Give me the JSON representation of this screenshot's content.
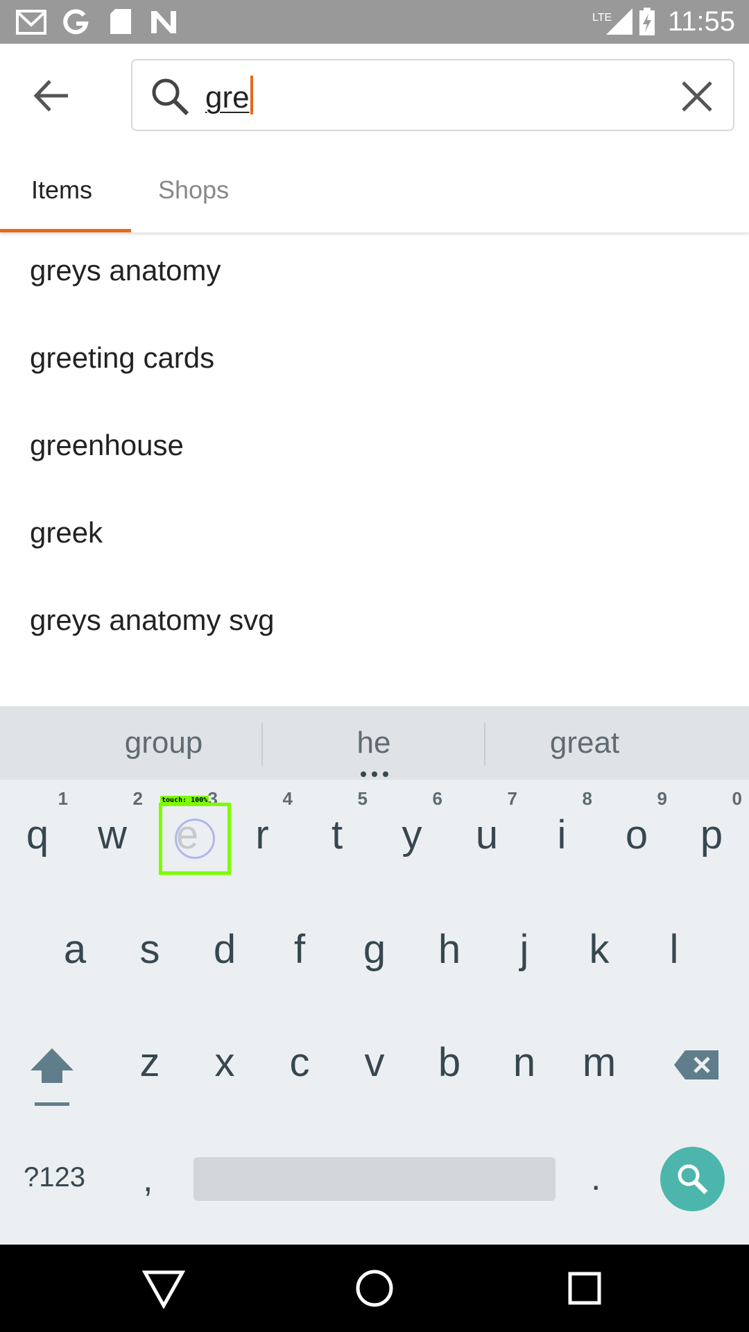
{
  "status_bar": {
    "time": "11:55",
    "network": "LTE",
    "icons": [
      "gmail-icon",
      "google-icon",
      "sd-card-icon",
      "notification-n-icon",
      "signal-icon",
      "battery-icon"
    ]
  },
  "header": {
    "back_icon": "arrow-back-icon",
    "search": {
      "value": "gre",
      "icon": "search-icon",
      "clear_icon": "close-icon"
    }
  },
  "tabs": [
    {
      "label": "Items",
      "active": true
    },
    {
      "label": "Shops",
      "active": false
    }
  ],
  "suggestions": [
    "greys anatomy",
    "greeting cards",
    "greenhouse",
    "greek",
    "greys anatomy svg"
  ],
  "keyboard": {
    "predictions": [
      "group",
      "he",
      "great"
    ],
    "row1": [
      {
        "key": "q",
        "hint": "1"
      },
      {
        "key": "w",
        "hint": "2"
      },
      {
        "key": "e",
        "hint": "3"
      },
      {
        "key": "r",
        "hint": "4"
      },
      {
        "key": "t",
        "hint": "5"
      },
      {
        "key": "y",
        "hint": "6"
      },
      {
        "key": "u",
        "hint": "7"
      },
      {
        "key": "i",
        "hint": "8"
      },
      {
        "key": "o",
        "hint": "9"
      },
      {
        "key": "p",
        "hint": "0"
      }
    ],
    "row2": [
      "a",
      "s",
      "d",
      "f",
      "g",
      "h",
      "j",
      "k",
      "l"
    ],
    "row3": [
      "z",
      "x",
      "c",
      "v",
      "b",
      "n",
      "m"
    ],
    "symbols_label": "?123",
    "comma_label": ",",
    "period_label": ".",
    "touch_label": "touch: 100%"
  },
  "colors": {
    "accent": "#e66a1b",
    "keyboard_bg": "#eceff1",
    "search_key": "#4db6ac",
    "touch_box": "#7cfc00"
  }
}
